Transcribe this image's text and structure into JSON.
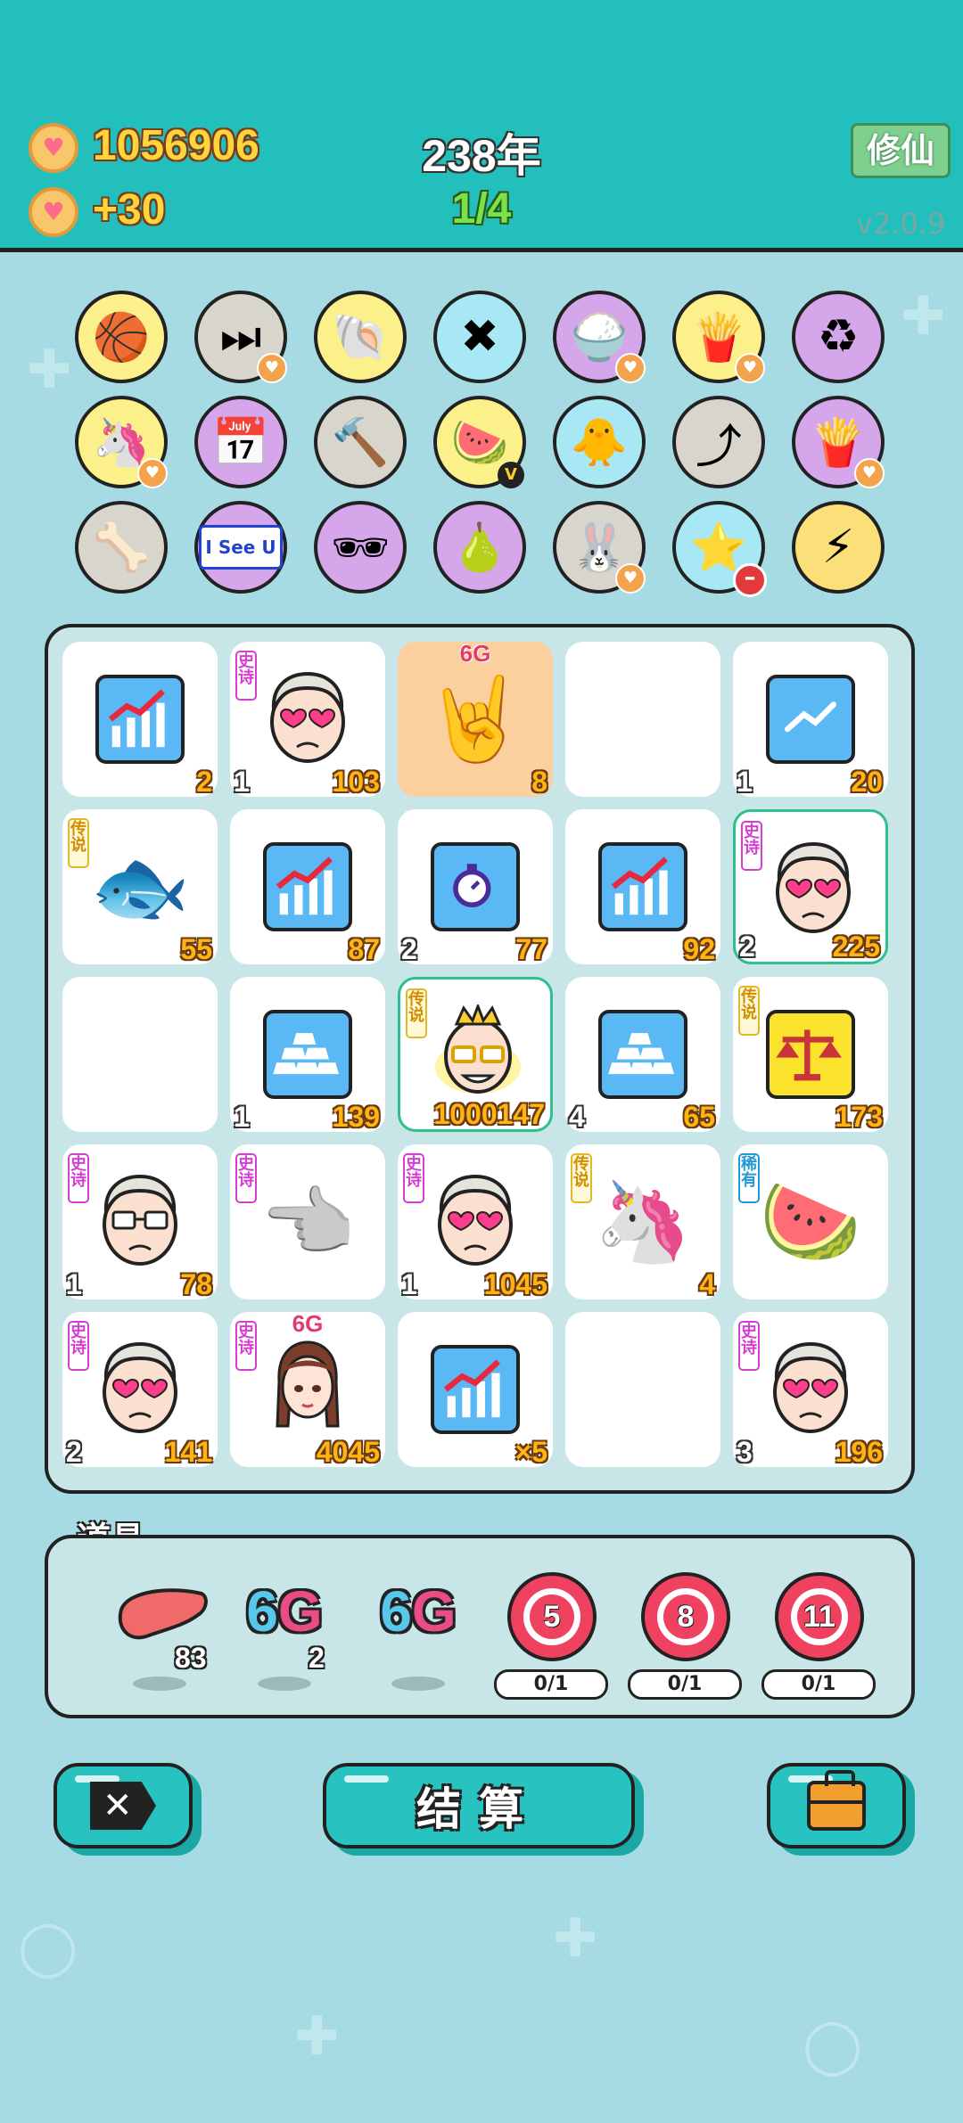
{
  "header": {
    "gold": "1056906",
    "income": "+30",
    "year": "238年",
    "progress": "1/4",
    "cultivate_label": "修仙",
    "version": "v2.0.9",
    "coin_icon": "heart-coin-icon"
  },
  "relics": [
    {
      "name": "basketballs-icon",
      "bg": "#fbf08a",
      "glyph": "🏀",
      "badge": ""
    },
    {
      "name": "skip-icon",
      "bg": "#d8d6cc",
      "glyph": "⏭",
      "badge": "heart"
    },
    {
      "name": "seashell-icon",
      "bg": "#fbf08a",
      "glyph": "🐚",
      "badge": ""
    },
    {
      "name": "crossed-sticks-icon",
      "bg": "#a8e8f4",
      "glyph": "✖",
      "badge": ""
    },
    {
      "name": "rice-bowl-icon",
      "bg": "#d6a6ea",
      "glyph": "🍚",
      "badge": "heart"
    },
    {
      "name": "fries-icon",
      "bg": "#fbf08a",
      "glyph": "🍟",
      "badge": "heart"
    },
    {
      "name": "recycle-icon",
      "bg": "#d6a6ea",
      "glyph": "♻",
      "badge": ""
    },
    {
      "name": "unicorn-icon",
      "bg": "#fbf08a",
      "glyph": "🦄",
      "badge": "heart"
    },
    {
      "name": "calendar-icon",
      "bg": "#d6a6ea",
      "glyph": "📅",
      "badge": ""
    },
    {
      "name": "hammer-icon",
      "bg": "#d8d6cc",
      "glyph": "🔨",
      "badge": ""
    },
    {
      "name": "fruit-basket-icon",
      "bg": "#fbf08a",
      "glyph": "🍉",
      "badge": "v"
    },
    {
      "name": "chick-egg-icon",
      "bg": "#a8e8f4",
      "glyph": "🐥",
      "badge": ""
    },
    {
      "name": "up-arrow-card-icon",
      "bg": "#d8d6cc",
      "glyph": "⤴",
      "badge": ""
    },
    {
      "name": "fries-icon-2",
      "bg": "#d6a6ea",
      "glyph": "🍟",
      "badge": "heart"
    },
    {
      "name": "dog-bowl-icon",
      "bg": "#d8d6cc",
      "glyph": "🦴",
      "badge": ""
    },
    {
      "name": "i-see-u-sign-icon",
      "bg": "#d6a6ea",
      "glyph": "I See U",
      "badge": ""
    },
    {
      "name": "eyepatch-icon",
      "bg": "#d6a6ea",
      "glyph": "🕶",
      "badge": ""
    },
    {
      "name": "pear-grapefruit-icon",
      "bg": "#d6a6ea",
      "glyph": "🍐",
      "badge": ""
    },
    {
      "name": "rabbit-icon",
      "bg": "#d8d6cc",
      "glyph": "🐰",
      "badge": "heart"
    },
    {
      "name": "star-plant-icon",
      "bg": "#a8e8f4",
      "glyph": "⭐",
      "badge": "minus"
    },
    {
      "name": "lightning-icon",
      "bg": "#fbe07a",
      "glyph": "⚡",
      "badge": ""
    }
  ],
  "board": [
    {
      "icon": "growth-chart-icon",
      "kind": "chart",
      "tag": "",
      "tag_text": "",
      "left": "",
      "right": "2",
      "hl": false,
      "top": ""
    },
    {
      "icon": "grandpa-heart-eyes-icon",
      "kind": "face",
      "tag": "epic",
      "tag_text": "史诗",
      "left": "1",
      "right": "103",
      "hl": false,
      "top": ""
    },
    {
      "icon": "rock-hand-icon",
      "kind": "hand",
      "tag": "",
      "tag_text": "",
      "left": "",
      "right": "8",
      "hl": false,
      "top": "6G",
      "orange": true
    },
    {
      "icon": "",
      "kind": "empty",
      "tag": "",
      "tag_text": "",
      "left": "",
      "right": "",
      "hl": false,
      "top": ""
    },
    {
      "icon": "trend-card-icon",
      "kind": "trend",
      "tag": "",
      "tag_text": "",
      "left": "1",
      "right": "20",
      "hl": false,
      "top": ""
    },
    {
      "icon": "koi-fish-icon",
      "kind": "fish",
      "tag": "legend",
      "tag_text": "传说",
      "left": "",
      "right": "55",
      "hl": false,
      "top": ""
    },
    {
      "icon": "growth-chart-icon",
      "kind": "chart",
      "tag": "",
      "tag_text": "",
      "left": "",
      "right": "87",
      "hl": false,
      "top": ""
    },
    {
      "icon": "stopwatch-card-icon",
      "kind": "watch",
      "tag": "",
      "tag_text": "",
      "left": "2",
      "right": "77",
      "hl": false,
      "top": ""
    },
    {
      "icon": "growth-chart-icon",
      "kind": "chart",
      "tag": "",
      "tag_text": "",
      "left": "",
      "right": "92",
      "hl": false,
      "top": ""
    },
    {
      "icon": "grandpa-heart-eyes-icon",
      "kind": "face",
      "tag": "epic",
      "tag_text": "史诗",
      "left": "2",
      "right": "225",
      "hl": true,
      "top": ""
    },
    {
      "icon": "",
      "kind": "empty",
      "tag": "",
      "tag_text": "",
      "left": "",
      "right": "",
      "hl": false,
      "top": ""
    },
    {
      "icon": "gold-bars-icon",
      "kind": "gold",
      "tag": "",
      "tag_text": "",
      "left": "1",
      "right": "139",
      "hl": false,
      "top": ""
    },
    {
      "icon": "king-grandpa-icon",
      "kind": "king",
      "tag": "legend",
      "tag_text": "传说",
      "left": "",
      "right": "1000147",
      "hl": true,
      "top": ""
    },
    {
      "icon": "gold-bars-icon",
      "kind": "gold",
      "tag": "",
      "tag_text": "",
      "left": "4",
      "right": "65",
      "hl": false,
      "top": ""
    },
    {
      "icon": "scales-card-icon",
      "kind": "scales",
      "tag": "legend",
      "tag_text": "传说",
      "left": "",
      "right": "173",
      "hl": false,
      "top": ""
    },
    {
      "icon": "grandpa-glasses-icon",
      "kind": "face-glasses",
      "tag": "epic",
      "tag_text": "史诗",
      "left": "1",
      "right": "78",
      "hl": false,
      "top": ""
    },
    {
      "icon": "pointing-hand-icon",
      "kind": "point",
      "tag": "epic",
      "tag_text": "史诗",
      "left": "",
      "right": "",
      "hl": false,
      "top": ""
    },
    {
      "icon": "grandpa-heart-eyes-icon",
      "kind": "face",
      "tag": "epic",
      "tag_text": "史诗",
      "left": "1",
      "right": "1045",
      "hl": false,
      "top": ""
    },
    {
      "icon": "unicorn-icon",
      "kind": "unicorn",
      "tag": "legend",
      "tag_text": "传说",
      "left": "",
      "right": "4",
      "hl": false,
      "top": ""
    },
    {
      "icon": "watermelon-icon",
      "kind": "melon",
      "tag": "rare",
      "tag_text": "稀有",
      "left": "",
      "right": "",
      "hl": false,
      "top": ""
    },
    {
      "icon": "grandpa-heart-eyes-icon",
      "kind": "face",
      "tag": "epic",
      "tag_text": "史诗",
      "left": "2",
      "right": "141",
      "hl": false,
      "top": ""
    },
    {
      "icon": "braided-girl-icon",
      "kind": "girl",
      "tag": "epic",
      "tag_text": "史诗",
      "left": "",
      "right": "4045",
      "hl": false,
      "top": "6G"
    },
    {
      "icon": "growth-chart-icon",
      "kind": "chart",
      "tag": "",
      "tag_text": "",
      "left": "",
      "right": "×5",
      "hl": false,
      "top": ""
    },
    {
      "icon": "",
      "kind": "empty",
      "tag": "",
      "tag_text": "",
      "left": "",
      "right": "",
      "hl": false,
      "top": ""
    },
    {
      "icon": "grandpa-heart-eyes-icon",
      "kind": "face",
      "tag": "epic",
      "tag_text": "史诗",
      "left": "3",
      "right": "196",
      "hl": false,
      "top": ""
    }
  ],
  "props": {
    "title": "道具",
    "liver_count": "83",
    "g6_a_count": "2",
    "g6_text_a": "6",
    "g6_text_b": "G",
    "targets": [
      {
        "value": "5",
        "progress": "0/1"
      },
      {
        "value": "8",
        "progress": "0/1"
      },
      {
        "value": "11",
        "progress": "0/1"
      }
    ]
  },
  "buttons": {
    "settle_label": "结算"
  }
}
